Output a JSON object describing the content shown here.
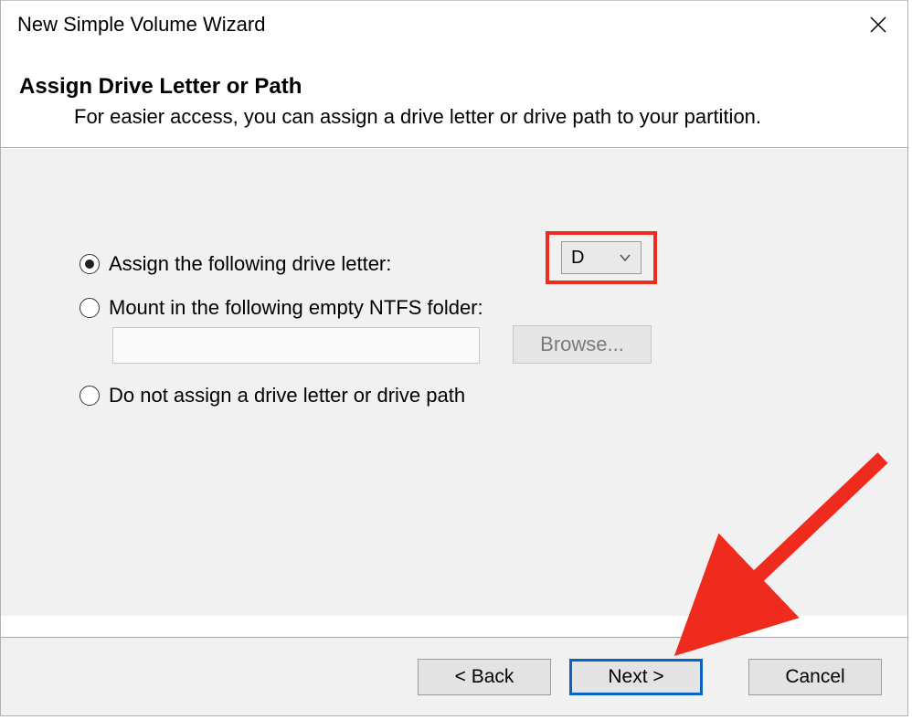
{
  "window": {
    "title": "New Simple Volume Wizard"
  },
  "header": {
    "title": "Assign Drive Letter or Path",
    "subtitle": "For easier access, you can assign a drive letter or drive path to your partition."
  },
  "options": {
    "assign_letter_label": "Assign the following drive letter:",
    "mount_label": "Mount in the following empty NTFS folder:",
    "no_assign_label": "Do not assign a drive letter or drive path",
    "drive_letter_value": "D",
    "ntfs_path_value": "",
    "browse_label": "Browse..."
  },
  "footer": {
    "back_label": "< Back",
    "next_label": "Next >",
    "cancel_label": "Cancel"
  }
}
